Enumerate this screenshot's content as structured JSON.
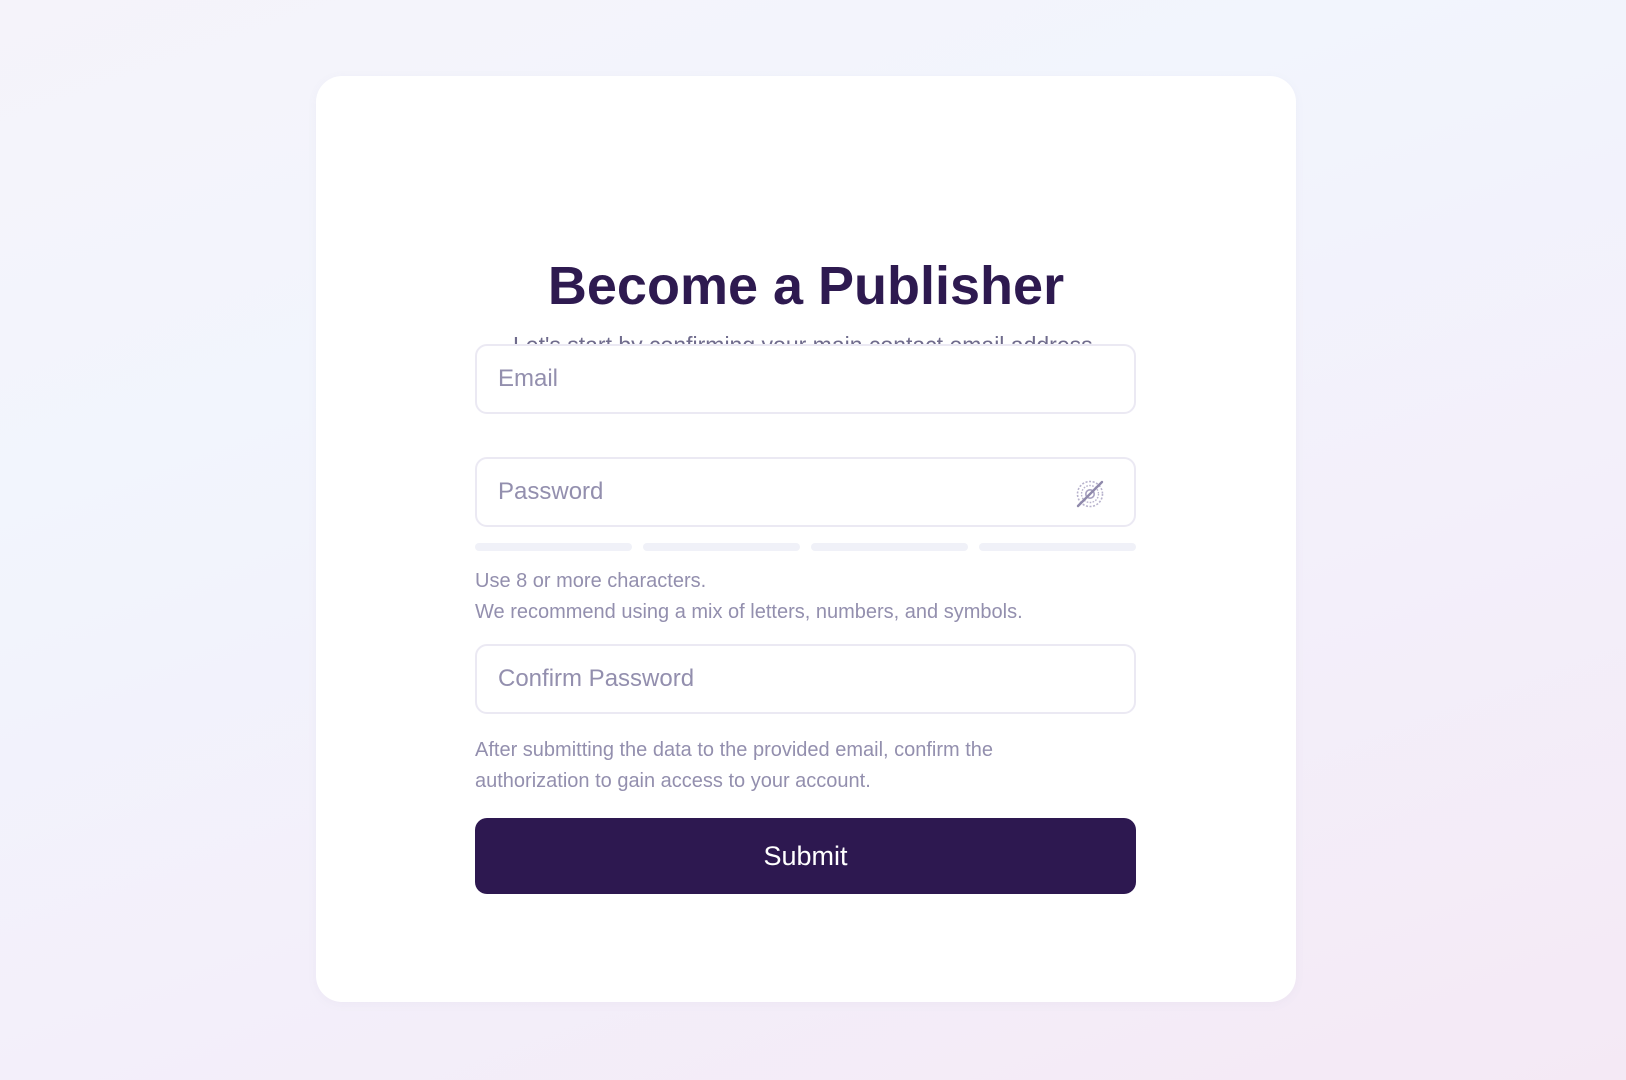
{
  "header": {
    "title": "Become a Publisher",
    "subtitle": "Let's start by confirming your main contact email address."
  },
  "form": {
    "email": {
      "placeholder": "Email",
      "value": ""
    },
    "password": {
      "placeholder": "Password",
      "value": "",
      "visibility_icon": "eye-off-icon",
      "strength_segments": 4,
      "strength_filled": 0,
      "hint_lines": [
        "Use 8 or more characters.",
        "We recommend using a mix of letters, numbers, and symbols."
      ]
    },
    "confirm_password": {
      "placeholder": "Confirm Password",
      "value": ""
    },
    "footer_hint_lines": [
      "After submitting the data to the provided email, confirm the",
      "authorization to gain access to your account."
    ],
    "submit_label": "Submit"
  },
  "colors": {
    "brand": "#2d1850",
    "title": "#2e1a50",
    "muted_text": "#938fae",
    "border": "#ebe9f3",
    "strength_empty": "#f0f1f8"
  }
}
